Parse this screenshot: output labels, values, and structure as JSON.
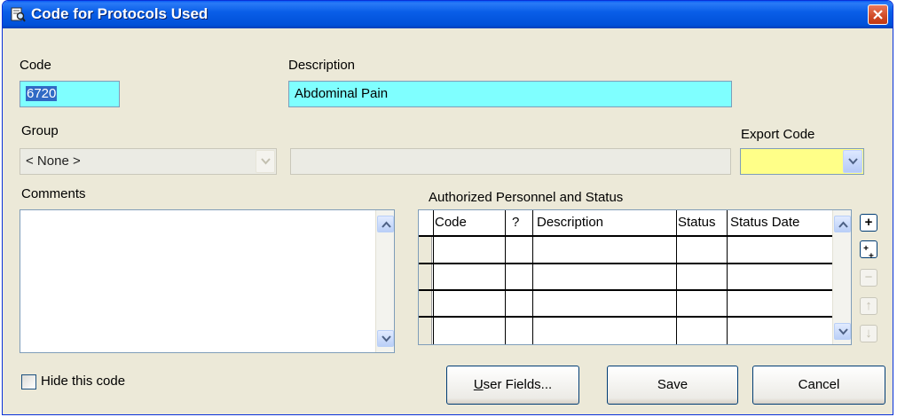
{
  "window": {
    "title": "Code for Protocols Used"
  },
  "code": {
    "label": "Code",
    "value": "6720"
  },
  "description": {
    "label": "Description",
    "value": "Abdominal Pain"
  },
  "group": {
    "label": "Group",
    "value": "< None >",
    "description_value": ""
  },
  "export_code": {
    "label": "Export Code",
    "value": ""
  },
  "comments": {
    "label": "Comments",
    "value": ""
  },
  "personnel": {
    "label": "Authorized Personnel and Status",
    "columns": [
      "Code",
      "?",
      "Description",
      "Status",
      "Status Date"
    ],
    "rows": [
      [
        "",
        "",
        "",
        "",
        ""
      ],
      [
        "",
        "",
        "",
        "",
        ""
      ],
      [
        "",
        "",
        "",
        "",
        ""
      ],
      [
        "",
        "",
        "",
        "",
        ""
      ]
    ]
  },
  "side_buttons": {
    "add": "+",
    "insert": "+",
    "insert_sub": "+",
    "remove": "−",
    "up": "↑",
    "down": "↓"
  },
  "hide_code": {
    "label": "Hide this code",
    "checked": false
  },
  "buttons": {
    "user_fields_u": "U",
    "user_fields_rest": "ser Fields...",
    "save": "Save",
    "cancel": "Cancel"
  },
  "colors": {
    "code_bg": "#7fffff",
    "export_bg": "#ffff88",
    "titlebar": "#0a5ee8"
  }
}
